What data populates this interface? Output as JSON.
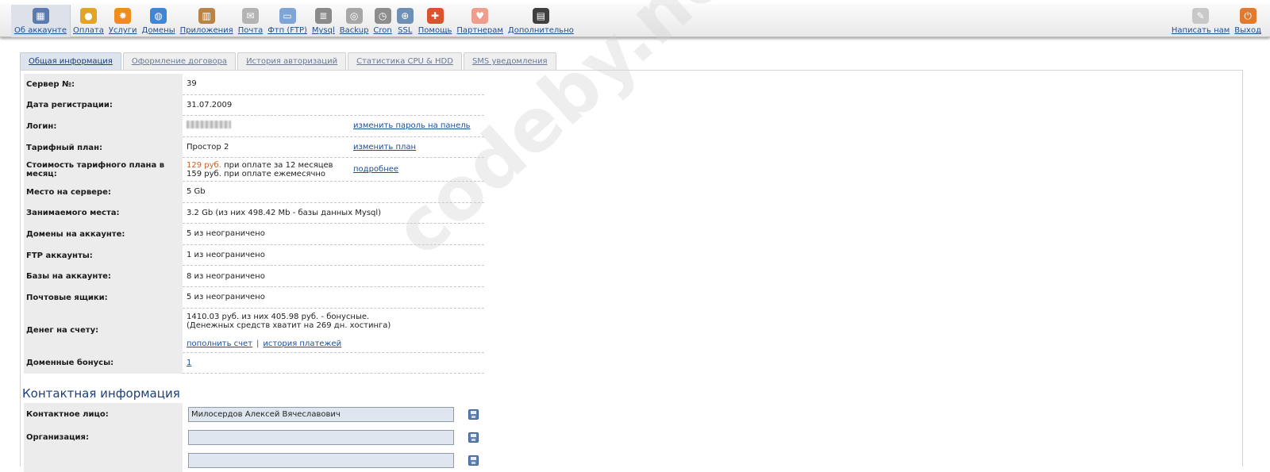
{
  "toolbar": {
    "left_items": [
      {
        "label": "Об аккаунте",
        "icon": "account-icon",
        "color": "#5a7ab0",
        "glyph": "▦"
      },
      {
        "label": "Оплата",
        "icon": "coins-icon",
        "color": "#e0a526",
        "glyph": "●"
      },
      {
        "label": "Услуги",
        "icon": "services-icon",
        "color": "#f08c1e",
        "glyph": "✹"
      },
      {
        "label": "Домены",
        "icon": "globe-icon",
        "color": "#3f86d4",
        "glyph": "◍"
      },
      {
        "label": "Приложения",
        "icon": "box-icon",
        "color": "#b98246",
        "glyph": "▥"
      },
      {
        "label": "Почта",
        "icon": "mail-icon",
        "color": "#b4b4b4",
        "glyph": "✉"
      },
      {
        "label": "Фтп (FTP)",
        "icon": "ftp-folder-icon",
        "color": "#7ea5d6",
        "glyph": "▭"
      },
      {
        "label": "Mysql",
        "icon": "database-icon",
        "color": "#8a8a8a",
        "glyph": "≣"
      },
      {
        "label": "Backup",
        "icon": "disc-icon",
        "color": "#a7a7a7",
        "glyph": "◎"
      },
      {
        "label": "Cron",
        "icon": "clock-icon",
        "color": "#8d8d8d",
        "glyph": "◷"
      },
      {
        "label": "SSL",
        "icon": "lock-icon",
        "color": "#6f8fb5",
        "glyph": "⊕"
      },
      {
        "label": "Помощь",
        "icon": "lifebuoy-icon",
        "color": "#d9532e",
        "glyph": "✚"
      },
      {
        "label": "Партнерам",
        "icon": "piggybank-icon",
        "color": "#ef9d8c",
        "glyph": "♥"
      },
      {
        "label": "Дополнительно",
        "icon": "device-icon",
        "color": "#404040",
        "glyph": "▤"
      }
    ],
    "right_items": [
      {
        "label": "Написать нам",
        "icon": "write-icon",
        "color": "#c8c8c8",
        "glyph": "✎"
      },
      {
        "label": "Выход",
        "icon": "power-icon",
        "color": "#e07a2e",
        "glyph": "⏻"
      }
    ]
  },
  "tabs": [
    {
      "label": "Общая информация",
      "active": true
    },
    {
      "label": "Оформление договора",
      "active": false
    },
    {
      "label": "История авторизаций",
      "active": false
    },
    {
      "label": "Статистика CPU & HDD",
      "active": false
    },
    {
      "label": "SMS уведомления",
      "active": false
    }
  ],
  "info": {
    "server": {
      "label": "Сервер №:",
      "value": "39"
    },
    "reg_date": {
      "label": "Дата регистрации:",
      "value": "31.07.2009"
    },
    "login": {
      "label": "Логин:",
      "action": "изменить пароль на панель"
    },
    "plan": {
      "label": "Тарифный план:",
      "value": "Простор 2",
      "action": "изменить план"
    },
    "cost": {
      "label": "Стоимость тарифного плана в месяц:",
      "price_12": "129 руб.",
      "price_12_note": "при оплате за 12 месяцев",
      "price_monthly": "159 руб. при оплате ежемесячно",
      "action": "подробнее"
    },
    "disk_space": {
      "label": "Место на сервере:",
      "value": "5 Gb"
    },
    "used_space": {
      "label": "Занимаемого места:",
      "value": "3.2 Gb (из них 498.42 Mb - базы данных Mysql)"
    },
    "domains": {
      "label": "Домены на аккаунте:",
      "value": "5 из неограничено"
    },
    "ftp": {
      "label": "FTP аккаунты:",
      "value": "1 из неограничено"
    },
    "databases": {
      "label": "Базы на аккаунте:",
      "value": "8 из неограничено"
    },
    "mailboxes": {
      "label": "Почтовые ящики:",
      "value": "5 из неограничено"
    },
    "balance": {
      "label": "Денег на счету:",
      "line1": "1410.03 руб. из них 405.98 руб. - бонусные.",
      "line2": "(Денежных средств хватит на 269 дн. хостинга)",
      "topup": "пополнить счет",
      "history": "история платежей",
      "separator": "|"
    },
    "domain_bonus": {
      "label": "Доменные бонусы:",
      "value": "1"
    }
  },
  "contact": {
    "title": "Контактная информация",
    "person": {
      "label": "Контактное лицо:",
      "value": "Милосердов Алексей Вячеславович"
    },
    "organization": {
      "label": "Организация:",
      "value": ""
    }
  },
  "watermark": "codeby.net"
}
